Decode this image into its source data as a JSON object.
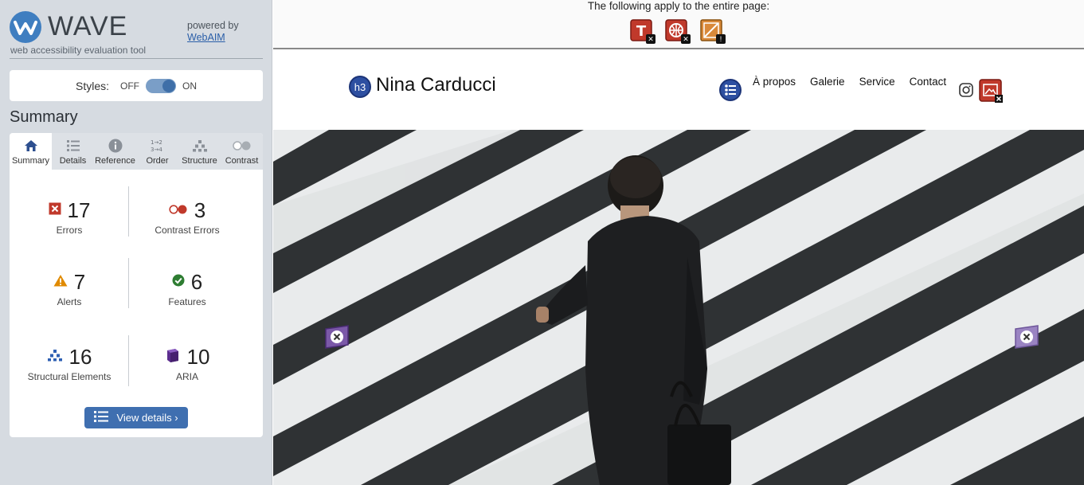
{
  "wave": {
    "wordmark": "WAVE",
    "tagline": "web accessibility evaluation tool",
    "powered_by": "powered by",
    "webaim_link": "WebAIM",
    "styles_label": "Styles:",
    "styles_off": "OFF",
    "styles_on": "ON",
    "summary_heading": "Summary",
    "tabs": [
      {
        "label": "Summary",
        "icon": "home-icon"
      },
      {
        "label": "Details",
        "icon": "list-icon"
      },
      {
        "label": "Reference",
        "icon": "info-icon"
      },
      {
        "label": "Order",
        "icon": "order-icon"
      },
      {
        "label": "Structure",
        "icon": "structure-icon"
      },
      {
        "label": "Contrast",
        "icon": "contrast-icon"
      }
    ],
    "stats": {
      "errors": {
        "count": "17",
        "label": "Errors",
        "color": "#c0392b"
      },
      "contrast_errors": {
        "count": "3",
        "label": "Contrast Errors",
        "color": "#c0392b"
      },
      "alerts": {
        "count": "7",
        "label": "Alerts",
        "color": "#e08a00"
      },
      "features": {
        "count": "6",
        "label": "Features",
        "color": "#2e7d32"
      },
      "structural": {
        "count": "16",
        "label": "Structural Elements",
        "color": "#2d5fb3"
      },
      "aria": {
        "count": "10",
        "label": "ARIA",
        "color": "#5b2d8e"
      }
    },
    "view_details": "View details ›"
  },
  "page_notice": {
    "text": "The following apply to the entire page:",
    "icons": [
      "missing-title-error-icon",
      "language-missing-error-icon",
      "no-heading-structure-alert-icon"
    ]
  },
  "site": {
    "title": "Nina Carducci",
    "heading_badge": "h3",
    "nav": [
      "À propos",
      "Galerie",
      "Service",
      "Contact"
    ],
    "icons": [
      "list-feature-icon",
      "instagram-icon",
      "image-alt-error-icon"
    ]
  },
  "colors": {
    "sidebar_bg": "#d6dbe1",
    "accent": "#3f6fb0",
    "error": "#c0392b",
    "alert": "#e08a00",
    "aria": "#7b59a8"
  }
}
